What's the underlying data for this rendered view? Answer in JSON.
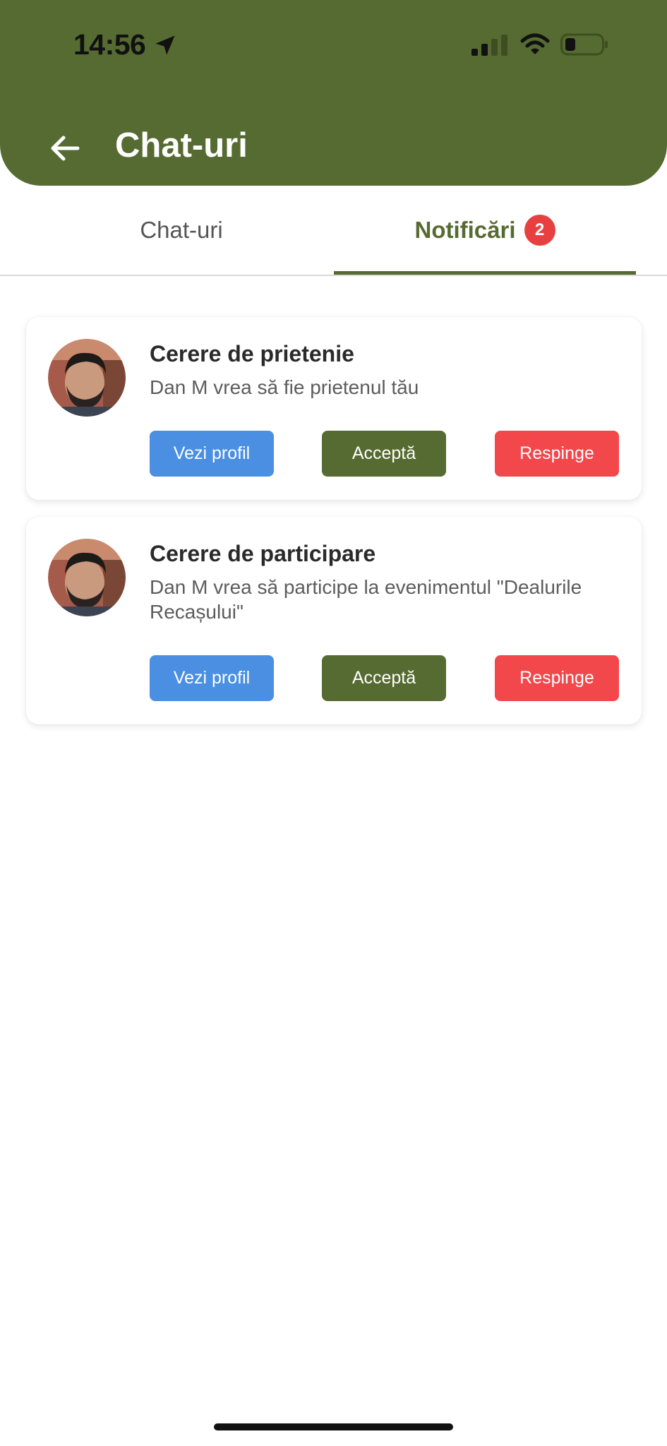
{
  "status_bar": {
    "time": "14:56",
    "icons": [
      "location-arrow-icon",
      "cellular-signal-icon",
      "wifi-icon",
      "battery-icon"
    ]
  },
  "header": {
    "title": "Chat-uri",
    "back_icon": "arrow-left-icon"
  },
  "tabs": {
    "items": [
      {
        "label": "Chat-uri",
        "active": false
      },
      {
        "label": "Notificări",
        "active": true,
        "badge": "2"
      }
    ]
  },
  "notifications": [
    {
      "title": "Cerere de prietenie",
      "text": "Dan M vrea să fie prietenul tău",
      "buttons": {
        "profile": "Vezi profil",
        "accept": "Acceptă",
        "reject": "Respinge"
      }
    },
    {
      "title": "Cerere de participare",
      "text": "Dan M vrea să participe la evenimentul \"Dealurile Recașului\"",
      "buttons": {
        "profile": "Vezi profil",
        "accept": "Acceptă",
        "reject": "Respinge"
      }
    }
  ],
  "colors": {
    "primary": "#566b31",
    "badge": "#e84040",
    "profile_button": "#4a8fe2",
    "reject_button": "#f2474b"
  }
}
